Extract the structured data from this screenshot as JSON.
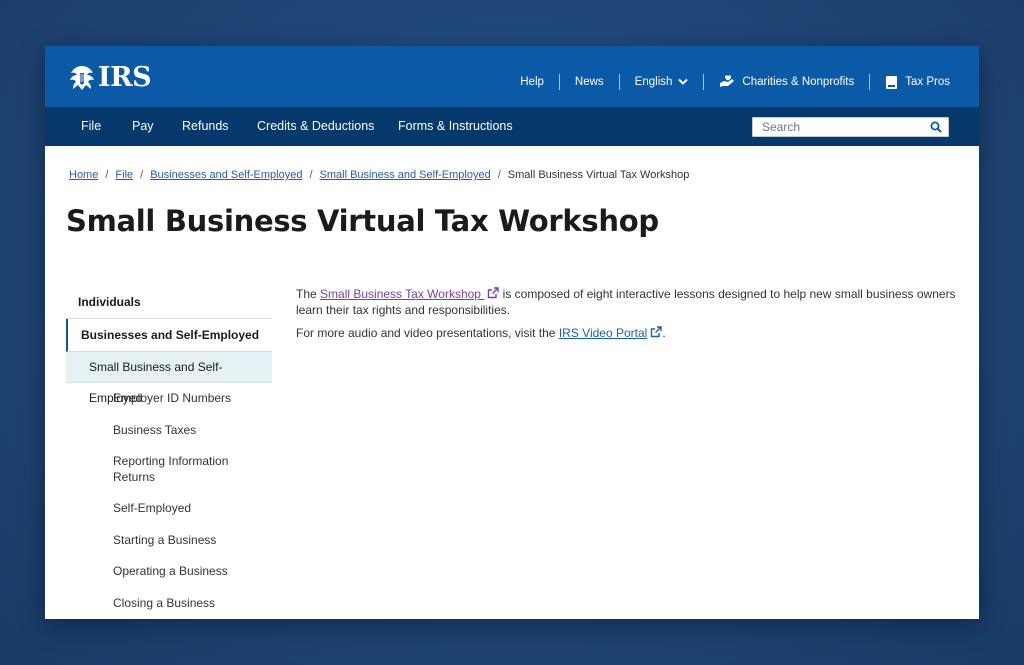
{
  "header": {
    "logo_text": "IRS",
    "links": [
      {
        "label": "Help"
      },
      {
        "label": "News"
      },
      {
        "label": "English"
      },
      {
        "label": "Charities & Nonprofits"
      },
      {
        "label": "Tax Pros"
      }
    ]
  },
  "nav": {
    "items": [
      "File",
      "Pay",
      "Refunds",
      "Credits & Deductions",
      "Forms & Instructions"
    ],
    "search_placeholder": "Search"
  },
  "breadcrumb": {
    "items": [
      "Home",
      "File",
      "Businesses and Self-Employed",
      "Small Business and Self-Employed"
    ],
    "current": "Small Business Virtual Tax Workshop"
  },
  "page_title": "Small Business Virtual Tax Workshop",
  "sidebar": {
    "top": "Individuals",
    "active": "Businesses and Self-Employed",
    "sub": "Small Business and Self-Employed",
    "leaves": [
      "Employer ID Numbers",
      "Business Taxes",
      "Reporting Information Returns",
      "Self-Employed",
      "Starting a Business",
      "Operating a Business",
      "Closing a Business"
    ]
  },
  "content": {
    "p1_prefix": "The ",
    "p1_link": "Small Business Tax Workshop ",
    "p1_suffix": " is composed of eight interactive lessons designed to help new small business owners learn their tax rights and responsibilities.",
    "p2_prefix": "For more audio and video presentations, visit the ",
    "p2_link": "IRS Video Portal",
    "p2_suffix": "."
  },
  "colors": {
    "header_blue": "#0b5aa8",
    "nav_navy": "#05386b",
    "visited_link": "#7a3fa0",
    "link_blue": "#1b5fae",
    "sidebar_highlight": "#e6f1f5"
  }
}
